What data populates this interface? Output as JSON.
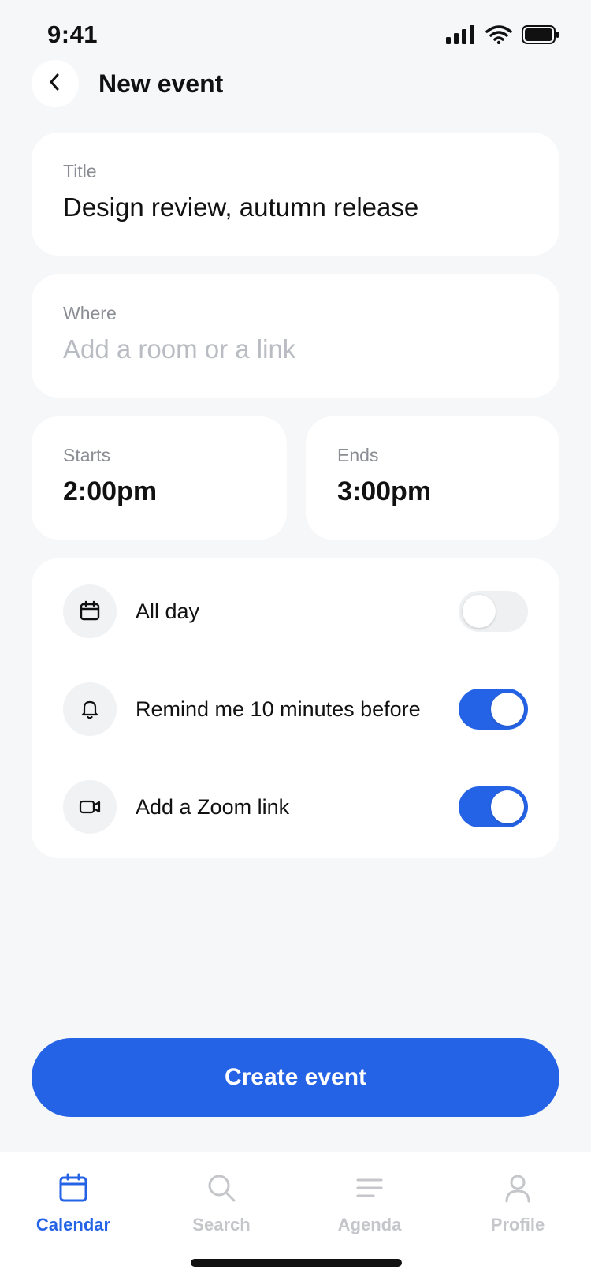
{
  "status_bar": {
    "time": "9:41"
  },
  "header": {
    "title": "New event",
    "back_icon": "chevron-left-icon"
  },
  "form": {
    "title_field": {
      "label": "Title",
      "value": "Design review, autumn release"
    },
    "where_field": {
      "label": "Where",
      "value": "",
      "placeholder": "Add a room or a link"
    },
    "starts": {
      "label": "Starts",
      "value": "2:00pm"
    },
    "ends": {
      "label": "Ends",
      "value": "3:00pm"
    }
  },
  "options": [
    {
      "label": "All day",
      "icon": "calendar-icon",
      "enabled": false
    },
    {
      "label": "Remind me 10 minutes before",
      "icon": "bell-icon",
      "enabled": true
    },
    {
      "label": "Add a Zoom link",
      "icon": "video-icon",
      "enabled": true
    }
  ],
  "primary_action": {
    "label": "Create event"
  },
  "tab_bar": {
    "tabs": [
      {
        "label": "Calendar",
        "icon": "calendar-icon",
        "active": true
      },
      {
        "label": "Search",
        "icon": "search-icon",
        "active": false
      },
      {
        "label": "Agenda",
        "icon": "list-icon",
        "active": false
      },
      {
        "label": "Profile",
        "icon": "person-icon",
        "active": false
      }
    ]
  },
  "colors": {
    "accent": "#2563e6",
    "background": "#f6f7f9",
    "card": "#ffffff",
    "label_gray": "#8a8d93",
    "placeholder_gray": "#b9bcc2",
    "inactive_tab": "#c4c6ca"
  }
}
